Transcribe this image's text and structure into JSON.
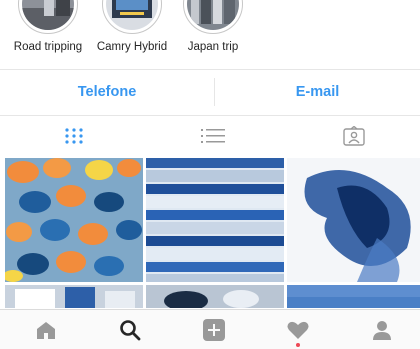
{
  "highlights": [
    {
      "label": "Road tripping"
    },
    {
      "label": "Camry Hybrid"
    },
    {
      "label": "Japan trip"
    }
  ],
  "contact": {
    "phone_label": "Telefone",
    "email_label": "E-mail"
  },
  "tabs": [
    {
      "icon": "grid-icon",
      "active": true
    },
    {
      "icon": "list-icon",
      "active": false
    },
    {
      "icon": "tagged-icon",
      "active": false
    }
  ],
  "nav": [
    {
      "icon": "home-icon"
    },
    {
      "icon": "search-icon",
      "active": true
    },
    {
      "icon": "add-post-icon"
    },
    {
      "icon": "activity-heart-icon",
      "notification": true
    },
    {
      "icon": "profile-icon"
    }
  ],
  "colors": {
    "link": "#3897f0",
    "notification": "#ed4956",
    "text": "#262626",
    "icon": "#999999"
  }
}
